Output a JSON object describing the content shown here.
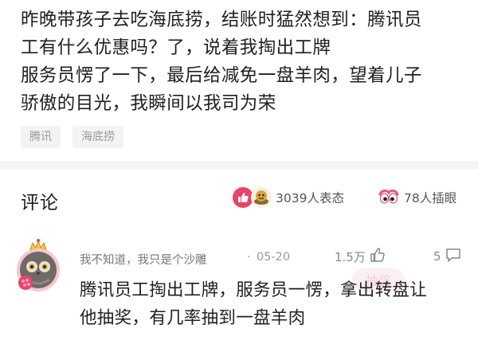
{
  "post": {
    "lines": [
      "昨晚带孩子去吃海底捞，结账时猛然想到：腾讯员",
      "工有什么优惠吗？了，说着我掏出工牌",
      "服务员愣了一下，最后给减免一盘羊肉，望着儿子",
      "骄傲的目光，我瞬间以我司为荣"
    ],
    "tags": [
      "腾讯",
      "海底捞"
    ]
  },
  "comments_section": {
    "title": "评论",
    "reactions_text": "3039人表态",
    "insert_pic_text": "78人插眼",
    "colors": {
      "like_reaction": "#e9436a",
      "insert_pic_icon": "#e05a7a"
    }
  },
  "comment": {
    "username": "我不知道，我只是个沙雕",
    "separator": "·",
    "timestamp": "05-20",
    "like_count": "1.5万",
    "reply_count": "5",
    "watermark_text": "抽奖",
    "body_lines": [
      "腾讯员工掏出工牌，服务员一愣，拿出转盘让",
      "他抽奖，有几率抽到一盘羊肉"
    ]
  }
}
